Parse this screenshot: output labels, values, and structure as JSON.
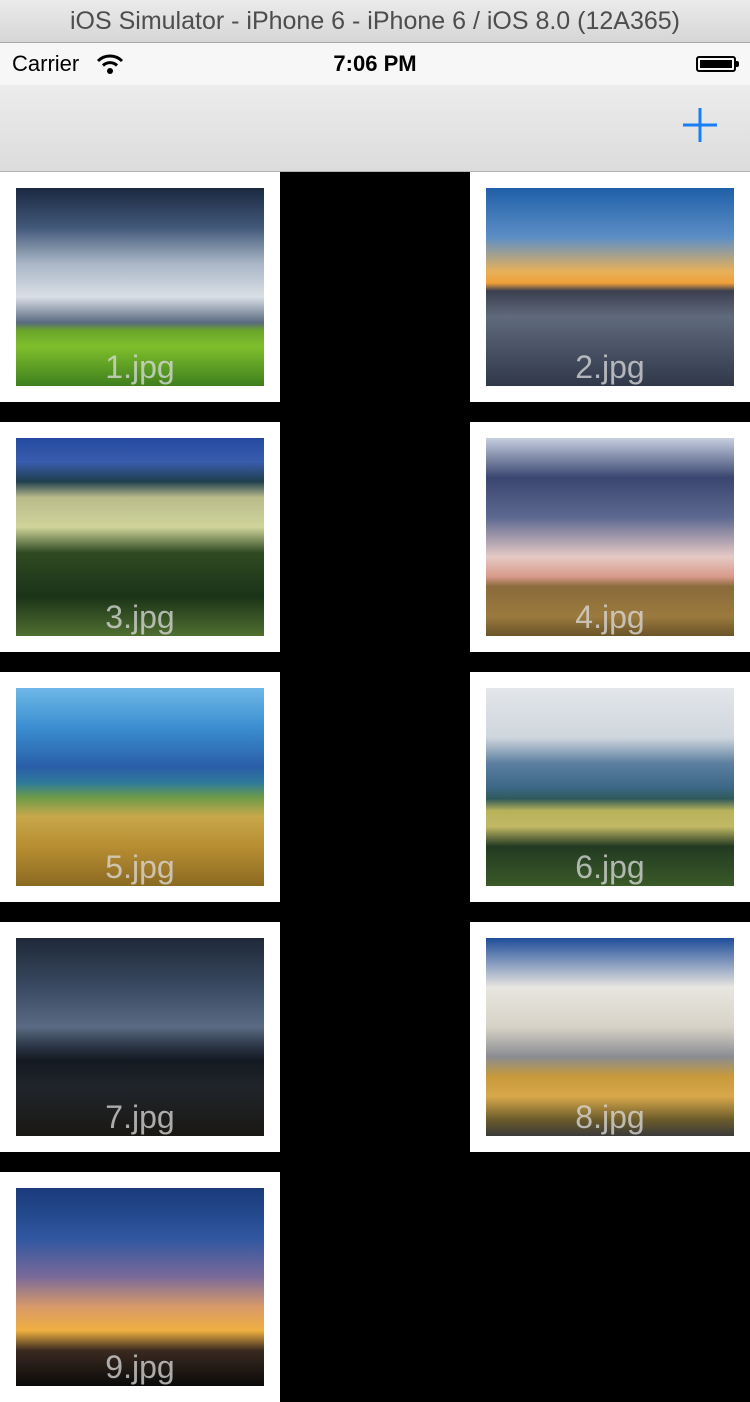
{
  "simulator": {
    "title": "iOS Simulator - iPhone 6 - iPhone 6 / iOS 8.0 (12A365)"
  },
  "status_bar": {
    "carrier": "Carrier",
    "time": "7:06 PM",
    "wifi_icon": "wifi-icon",
    "battery_icon": "battery-icon"
  },
  "nav_bar": {
    "add_icon": "plus-icon",
    "accent_color": "#1a7ef5"
  },
  "photos": [
    {
      "caption": "1.jpg"
    },
    {
      "caption": "2.jpg"
    },
    {
      "caption": "3.jpg"
    },
    {
      "caption": "4.jpg"
    },
    {
      "caption": "5.jpg"
    },
    {
      "caption": "6.jpg"
    },
    {
      "caption": "7.jpg"
    },
    {
      "caption": "8.jpg"
    },
    {
      "caption": "9.jpg"
    }
  ]
}
